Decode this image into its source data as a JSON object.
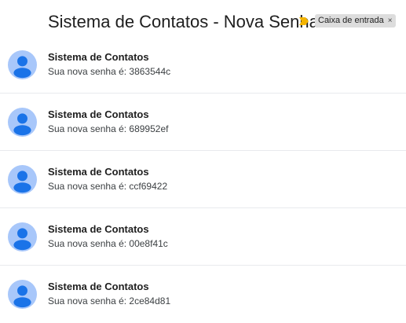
{
  "thread": {
    "subject": "Sistema de Contatos - Nova Senha",
    "label": "Caixa de entrada",
    "label_close": "×"
  },
  "colors": {
    "important_marker": "#f4b400",
    "avatar_bg": "#a8c7fa",
    "avatar_fg": "#1a73e8"
  },
  "messages": [
    {
      "sender": "Sistema de Contatos",
      "snippet": "Sua nova senha é: 3863544c"
    },
    {
      "sender": "Sistema de Contatos",
      "snippet": "Sua nova senha é: 689952ef"
    },
    {
      "sender": "Sistema de Contatos",
      "snippet": "Sua nova senha é: ccf69422"
    },
    {
      "sender": "Sistema de Contatos",
      "snippet": "Sua nova senha é: 00e8f41c"
    },
    {
      "sender": "Sistema de Contatos",
      "snippet": "Sua nova senha é: 2ce84d81"
    }
  ]
}
